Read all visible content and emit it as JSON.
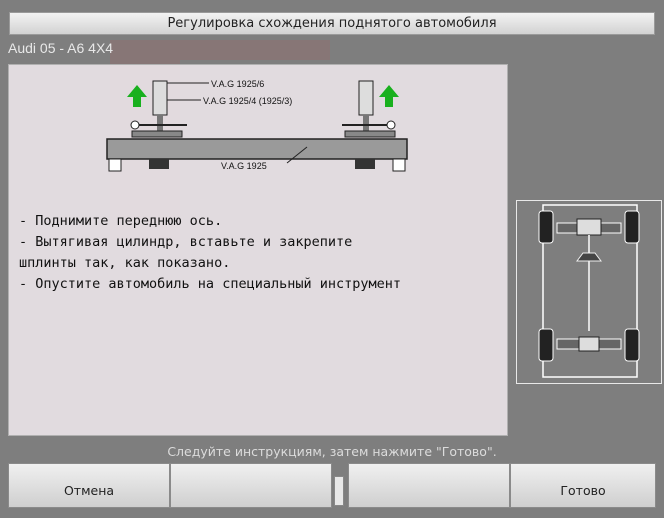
{
  "window": {
    "title": "Регулировка схождения поднятого автомобиля"
  },
  "vehicle": "Audi 05 - A6 4X4",
  "diagram": {
    "tool_labels": [
      "V.A.G 1925/6",
      "V.A.G 1925/4  (1925/3)",
      "V.A.G 1925"
    ]
  },
  "instructions": [
    "- Поднимите переднюю ось.",
    "- Вытягивая цилиндр, вставьте и закрепите",
    "шплинты так, как показано.",
    "- Опустите автомобиль на специальный инструмент"
  ],
  "status": "Следуйте инструкциям, затем нажмите \"Готово\".",
  "footer": {
    "cancel_label": "Отмена",
    "done_label": "Готово"
  },
  "colors": {
    "arrow": "#19b01e",
    "title_bar": "#e2e2e2",
    "panel": "#e8e2e6"
  }
}
